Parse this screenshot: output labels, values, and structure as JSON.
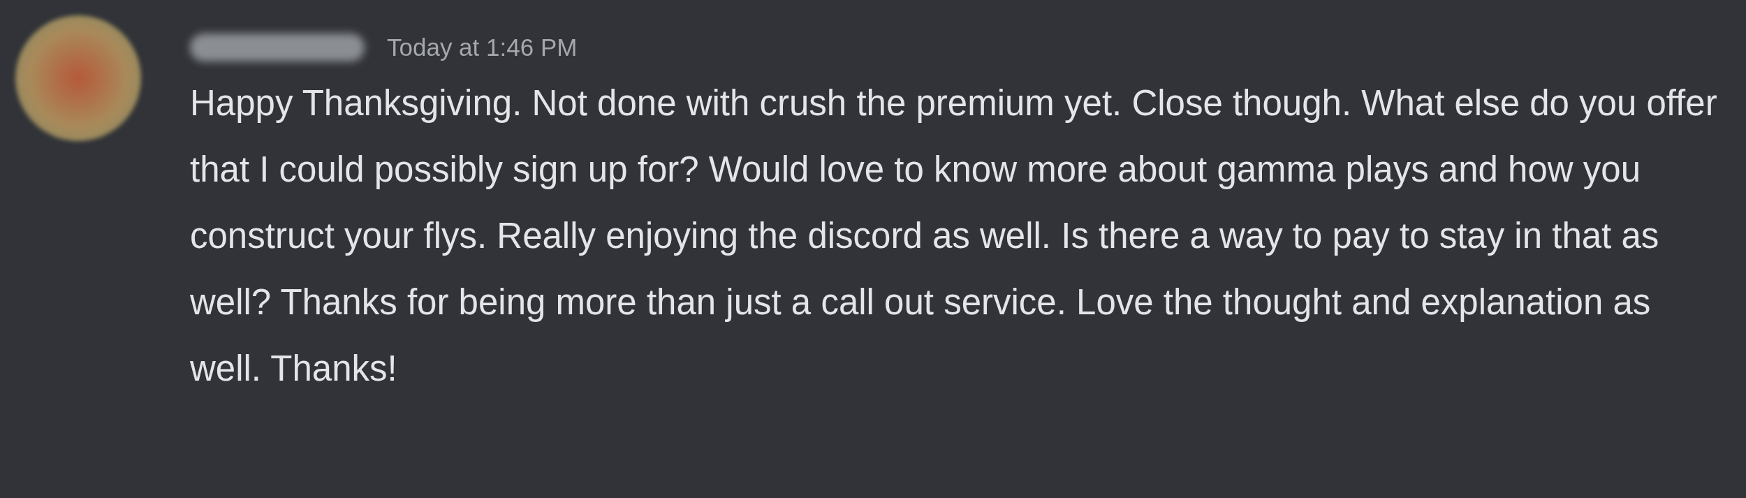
{
  "message": {
    "timestamp": "Today at 1:46 PM",
    "text": "Happy Thanksgiving. Not done with crush the premium yet. Close though. What else do you offer that I could possibly sign up for? Would love to know more about gamma plays and how you construct your flys. Really enjoying the discord as well. Is there a way to pay to stay in that as well? Thanks for being more than just a call out service. Love the thought and explanation as well. Thanks!"
  }
}
